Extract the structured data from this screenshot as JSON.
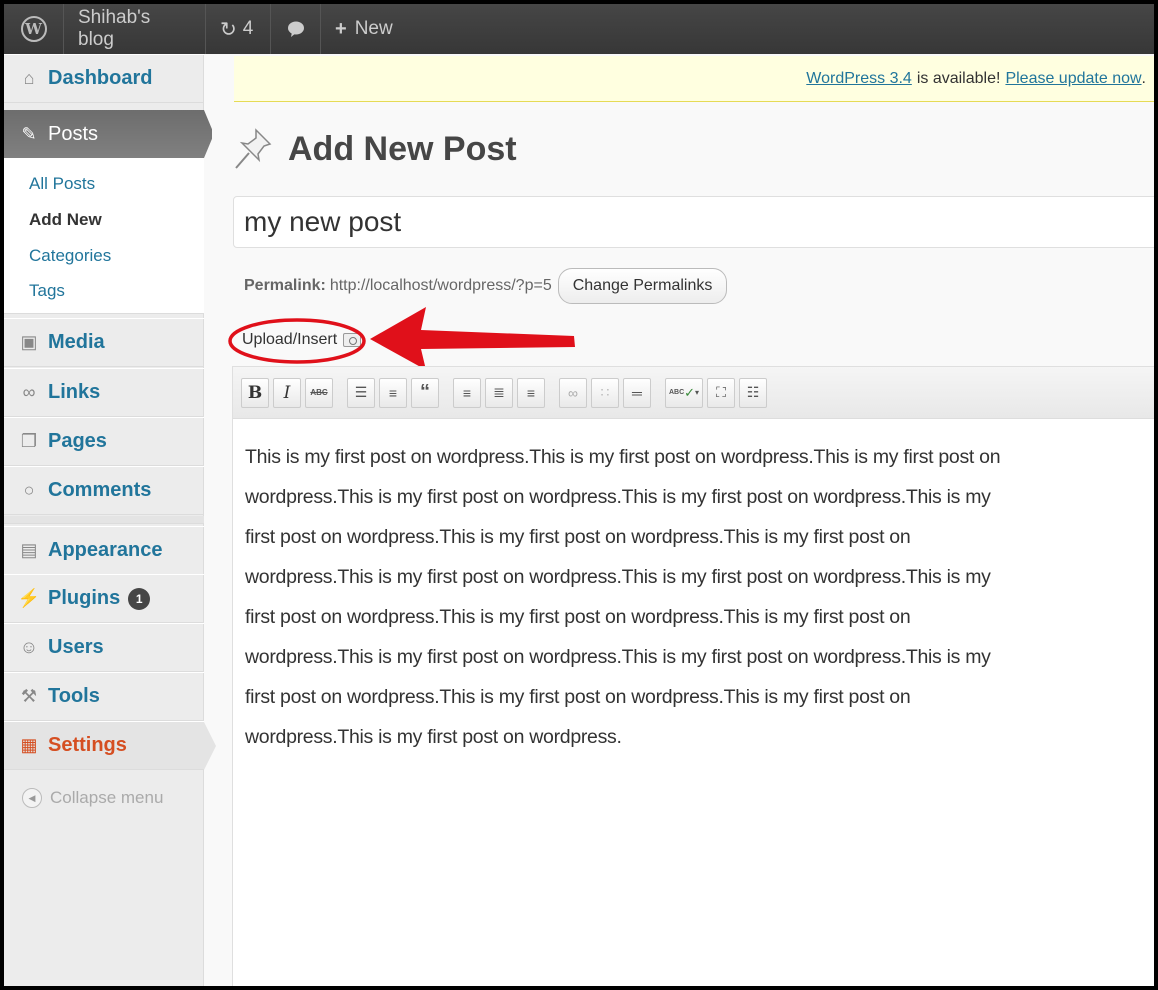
{
  "adminbar": {
    "site_name": "Shihab's blog",
    "updates_count": "4",
    "new_label": "New",
    "logo_letter": "W"
  },
  "sidebar": {
    "dashboard": "Dashboard",
    "posts": "Posts",
    "submenu": [
      "All Posts",
      "Add New",
      "Categories",
      "Tags"
    ],
    "media": "Media",
    "links": "Links",
    "pages": "Pages",
    "comments": "Comments",
    "appearance": "Appearance",
    "plugins": "Plugins",
    "plugins_badge": "1",
    "users": "Users",
    "tools": "Tools",
    "settings": "Settings",
    "collapse": "Collapse menu"
  },
  "notice": {
    "version_link": "WordPress 3.4",
    "text": "is available!",
    "update_link": "Please update now",
    "period": "."
  },
  "page": {
    "title": "Add New Post",
    "post_title_value": "my new post",
    "permalink_label": "Permalink:",
    "permalink_url": "http://localhost/wordpress/?p=5",
    "change_permalinks": "Change Permalinks",
    "upload_insert": "Upload/Insert"
  },
  "toolbar": {
    "bold": "B",
    "italic": "I",
    "strikethrough": "ABC",
    "spellcheck": "ABC"
  },
  "editor": {
    "content": "This is my first post on wordpress.This is my first post on wordpress.This is my first post on wordpress.This is my first post on wordpress.This is my first post on wordpress.This is my first post on wordpress.This is my first post on wordpress.This is my first post on wordpress.This is my first post on wordpress.This is my first post on wordpress.This is my first post on wordpress.This is my first post on wordpress.This is my first post on wordpress.This is my first post on wordpress.This is my first post on wordpress.This is my first post on wordpress.This is my first post on wordpress.This is my first post on wordpress.This is my first post on wordpress."
  },
  "colors": {
    "link": "#21759b",
    "current_menu": "#d54e21",
    "annotation": "#e0101a",
    "notice_bg": "#ffffe0"
  }
}
